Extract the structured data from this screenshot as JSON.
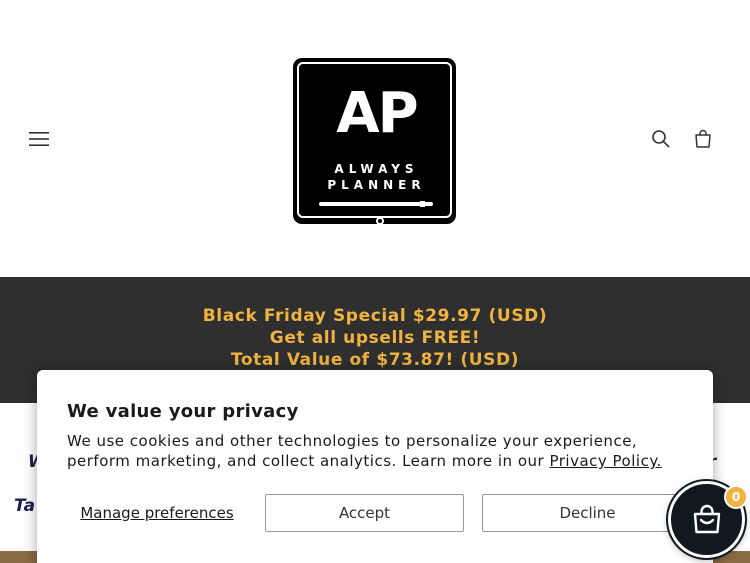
{
  "header": {
    "menu_icon": "hamburger-menu-icon",
    "search_icon": "search-icon",
    "cart_icon": "cart-icon",
    "logo": {
      "letters": "AP",
      "line1": "ALWAYS",
      "line2": "PLANNER"
    }
  },
  "announcement": {
    "line1": "Black Friday Special $29.97 (USD)",
    "line2": "Get all upsells FREE!",
    "line3": "Total Value of $73.87! (USD)",
    "text_color": "#f0b341",
    "background": "#2f2f2f"
  },
  "background_content": {
    "left_fragment_1": "W",
    "left_fragment_2": "Ta",
    "right_fragment": "r"
  },
  "privacy": {
    "title": "We value your privacy",
    "body": "We use cookies and other technologies to personalize your experience, perform marketing, and collect analytics. Learn more in our ",
    "link": "Privacy Policy.",
    "manage_label": "Manage preferences",
    "accept_label": "Accept",
    "decline_label": "Decline"
  },
  "floating_cart": {
    "icon": "shopping-bag-icon",
    "count": "0",
    "badge_color": "#f0b341"
  }
}
